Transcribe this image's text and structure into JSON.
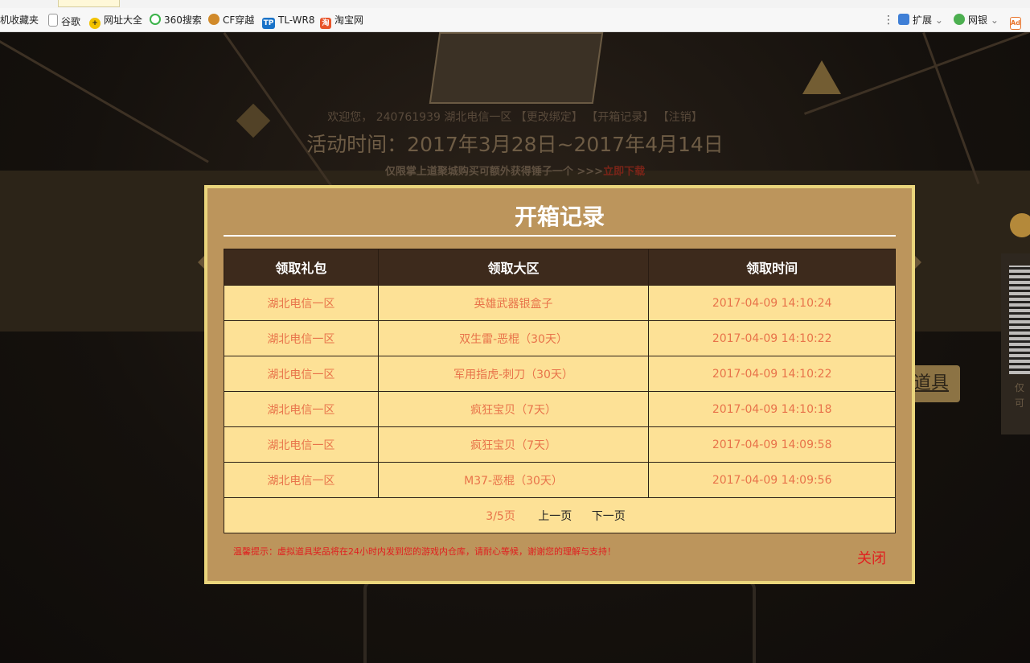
{
  "bookmarks": [
    {
      "label": "机收藏夹",
      "icon": "folder-icon"
    },
    {
      "label": "谷歌",
      "icon": "page-icon"
    },
    {
      "label": "网址大全",
      "icon": "nav-site-icon"
    },
    {
      "label": "360搜索",
      "icon": "search-360-icon"
    },
    {
      "label": "CF穿越",
      "icon": "cf-game-icon"
    },
    {
      "label": "TL-WR8",
      "icon": "router-icon"
    },
    {
      "label": "淘宝网",
      "icon": "taobao-icon"
    }
  ],
  "toolbar_right": {
    "extensions_label": "扩展",
    "netbank_label": "网银",
    "ad_label": "Ad"
  },
  "page": {
    "welcome": "欢迎您， 240761939 湖北电信一区 【更改绑定】 【开箱记录】 【注销】",
    "activity_time": "活动时间：2017年3月28日~2017年4月14日",
    "notice_text": "仅限掌上道聚城购买可额外获得锤子一个 >>>",
    "notice_link": "立即下载",
    "right_button": "道具",
    "right_panel_line1": "仅",
    "right_panel_line2": "可"
  },
  "modal": {
    "title": "开箱记录",
    "columns": [
      "领取礼包",
      "领取大区",
      "领取时间"
    ],
    "rows": [
      {
        "gift": "湖北电信一区",
        "zone": "英雄武器银盒子",
        "time": "2017-04-09 14:10:24"
      },
      {
        "gift": "湖北电信一区",
        "zone": "双生雷-恶棍（30天）",
        "time": "2017-04-09 14:10:22"
      },
      {
        "gift": "湖北电信一区",
        "zone": "军用指虎-刺刀（30天）",
        "time": "2017-04-09 14:10:22"
      },
      {
        "gift": "湖北电信一区",
        "zone": "疯狂宝贝（7天）",
        "time": "2017-04-09 14:10:18"
      },
      {
        "gift": "湖北电信一区",
        "zone": "疯狂宝贝（7天）",
        "time": "2017-04-09 14:09:58"
      },
      {
        "gift": "湖北电信一区",
        "zone": "M37-恶棍（30天）",
        "time": "2017-04-09 14:09:56"
      }
    ],
    "pager": {
      "page_info": "3/5页",
      "prev": "上一页",
      "next": "下一页"
    },
    "tip": "温馨提示：虚拟道具奖品将在24小时内发到您的游戏内仓库，请耐心等候，谢谢您的理解与支持！",
    "close": "关闭"
  },
  "colors": {
    "modal_bg": "#bc955c",
    "modal_border": "#ead57c",
    "header_bg": "#3d2a1c",
    "cell_bg": "#fde196",
    "cell_text": "#e8734a",
    "tip_text": "#e02020"
  }
}
